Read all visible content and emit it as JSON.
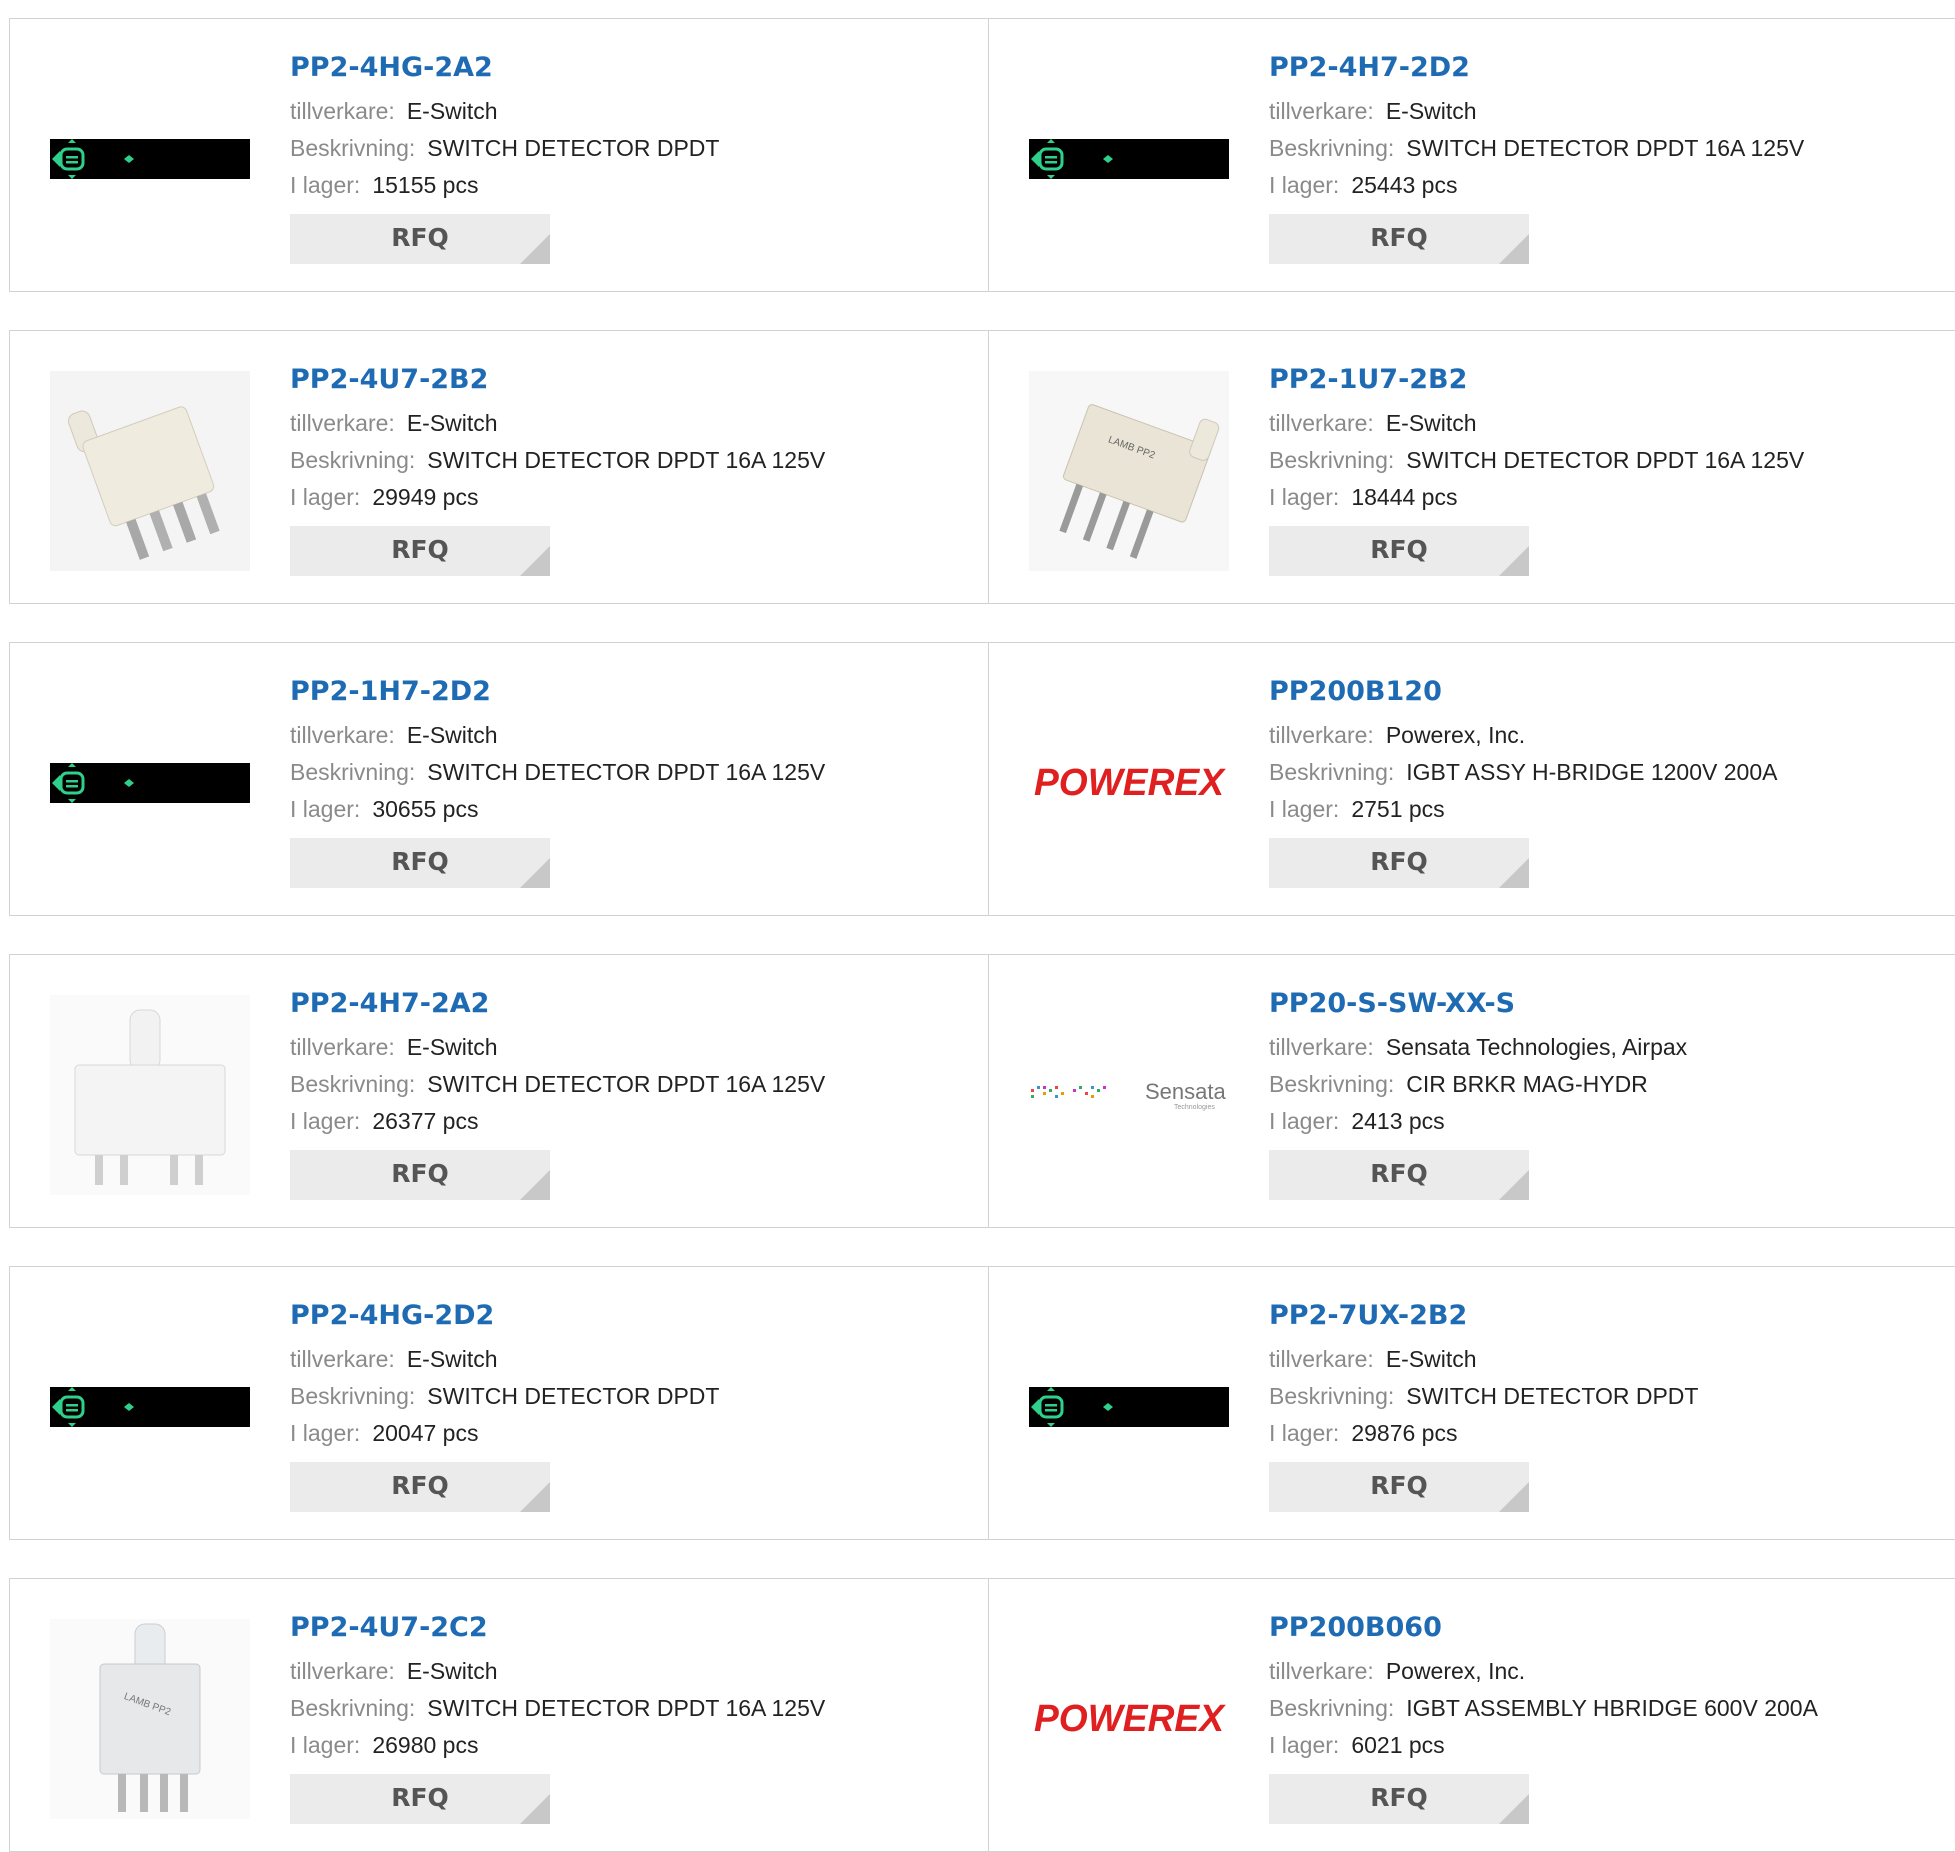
{
  "labels": {
    "manufacturer": "tillverkare:",
    "description": "Beskrivning:",
    "stock": "I lager:",
    "rfq": "RFQ"
  },
  "products": [
    {
      "part": "PP2-4HG-2A2",
      "manufacturer": "E-Switch",
      "description": "SWITCH DETECTOR DPDT",
      "stock": "15155 pcs",
      "image": "black-strip"
    },
    {
      "part": "PP2-4H7-2D2",
      "manufacturer": "E-Switch",
      "description": "SWITCH DETECTOR DPDT 16A 125V",
      "stock": "25443 pcs",
      "image": "black-strip"
    },
    {
      "part": "PP2-4U7-2B2",
      "manufacturer": "E-Switch",
      "description": "SWITCH DETECTOR DPDT 16A 125V",
      "stock": "29949 pcs",
      "image": "switch-angled"
    },
    {
      "part": "PP2-1U7-2B2",
      "manufacturer": "E-Switch",
      "description": "SWITCH DETECTOR DPDT 16A 125V",
      "stock": "18444 pcs",
      "image": "switch-side"
    },
    {
      "part": "PP2-1H7-2D2",
      "manufacturer": "E-Switch",
      "description": "SWITCH DETECTOR DPDT 16A 125V",
      "stock": "30655 pcs",
      "image": "black-strip"
    },
    {
      "part": "PP200B120",
      "manufacturer": "Powerex, Inc.",
      "description": "IGBT ASSY H-BRIDGE 1200V 200A",
      "stock": "2751 pcs",
      "image": "powerex-logo"
    },
    {
      "part": "PP2-4H7-2A2",
      "manufacturer": "E-Switch",
      "description": "SWITCH DETECTOR DPDT 16A 125V",
      "stock": "26377 pcs",
      "image": "switch-upright"
    },
    {
      "part": "PP20-S-SW-XX-S",
      "manufacturer": "Sensata Technologies, Airpax",
      "description": "CIR BRKR MAG-HYDR",
      "stock": "2413 pcs",
      "image": "sensata-logo"
    },
    {
      "part": "PP2-4HG-2D2",
      "manufacturer": "E-Switch",
      "description": "SWITCH DETECTOR DPDT",
      "stock": "20047 pcs",
      "image": "black-strip"
    },
    {
      "part": "PP2-7UX-2B2",
      "manufacturer": "E-Switch",
      "description": "SWITCH DETECTOR DPDT",
      "stock": "29876 pcs",
      "image": "black-strip"
    },
    {
      "part": "PP2-4U7-2C2",
      "manufacturer": "E-Switch",
      "description": "SWITCH DETECTOR DPDT 16A 125V",
      "stock": "26980 pcs",
      "image": "switch-labeled"
    },
    {
      "part": "PP200B060",
      "manufacturer": "Powerex, Inc.",
      "description": "IGBT ASSEMBLY HBRIDGE 600V 200A",
      "stock": "6021 pcs",
      "image": "powerex-logo"
    }
  ],
  "logos": {
    "powerex": "POWEREX",
    "sensata": "Sensata",
    "sensata_sub": "Technologies"
  },
  "colors": {
    "link": "#1f6bb3",
    "label": "#8a8a8a",
    "value": "#222222",
    "border": "#d2d2d2",
    "rfq_bg": "#ebebeb",
    "powerex_red": "#e02020",
    "strip_green": "#2fd08a"
  }
}
